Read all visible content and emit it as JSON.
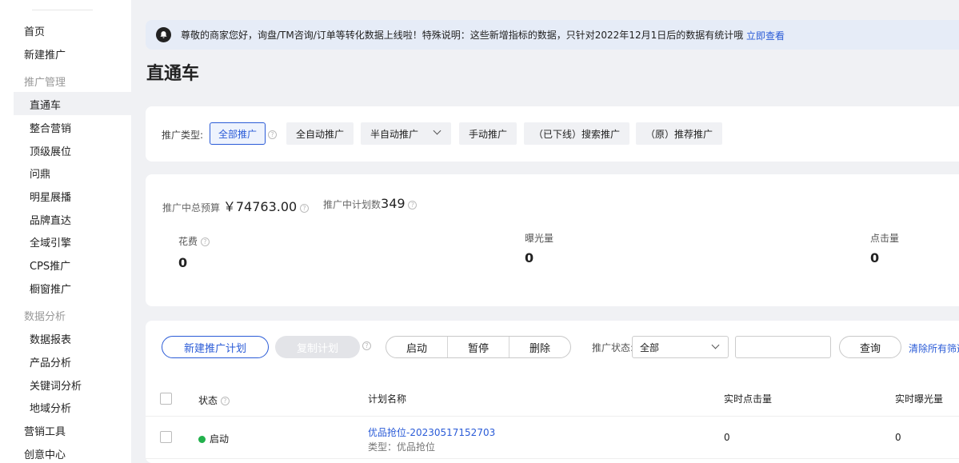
{
  "sidebar": {
    "top_items": [
      "首页",
      "新建推广"
    ],
    "groups": [
      {
        "label": "推广管理",
        "items": [
          "直通车",
          "整合营销",
          "顶级展位",
          "问鼎",
          "明星展播",
          "品牌直达",
          "全域引擎",
          "CPS推广",
          "橱窗推广"
        ]
      },
      {
        "label": "数据分析",
        "items": [
          "数据报表",
          "产品分析",
          "关键词分析",
          "地域分析"
        ]
      }
    ],
    "bottom_items": [
      "营销工具",
      "创意中心"
    ],
    "active": "直通车"
  },
  "notice": {
    "text": "尊敬的商家您好，询盘/TM咨询/订单等转化数据上线啦！特殊说明：这些新增指标的数据，只针对2022年12月1日后的数据有统计哦",
    "link": "立即查看"
  },
  "page_title": "直通车",
  "filter": {
    "label": "推广类型:",
    "types": [
      "全部推广",
      "全自动推广",
      "半自动推广",
      "手动推广",
      "（已下线）搜索推广",
      "（原）推荐推广"
    ],
    "active": "全部推广"
  },
  "summary": {
    "budget_label": "推广中总预算",
    "budget_value": "￥74763.00",
    "plans_label": "推广中计划数",
    "plans_value": "349",
    "metrics": [
      {
        "label": "花费",
        "value": "0"
      },
      {
        "label": "曝光量",
        "value": "0"
      },
      {
        "label": "点击量",
        "value": "0"
      }
    ]
  },
  "toolbar": {
    "new_plan": "新建推广计划",
    "copy_plan": "复制计划",
    "start": "启动",
    "pause": "暂停",
    "delete": "删除",
    "status_label": "推广状态:",
    "status_value": "全部",
    "query": "查询",
    "clear": "清除所有筛选"
  },
  "table": {
    "headers": [
      "状态",
      "计划名称",
      "实时点击量",
      "实时曝光量"
    ],
    "rows": [
      {
        "status": "启动",
        "name": "优品抢位-20230517152703",
        "type": "类型：优品抢位",
        "clicks": "0",
        "impressions": "0"
      }
    ]
  },
  "colors": {
    "accent": "#2a5bd7",
    "status_on": "#22b14c"
  }
}
